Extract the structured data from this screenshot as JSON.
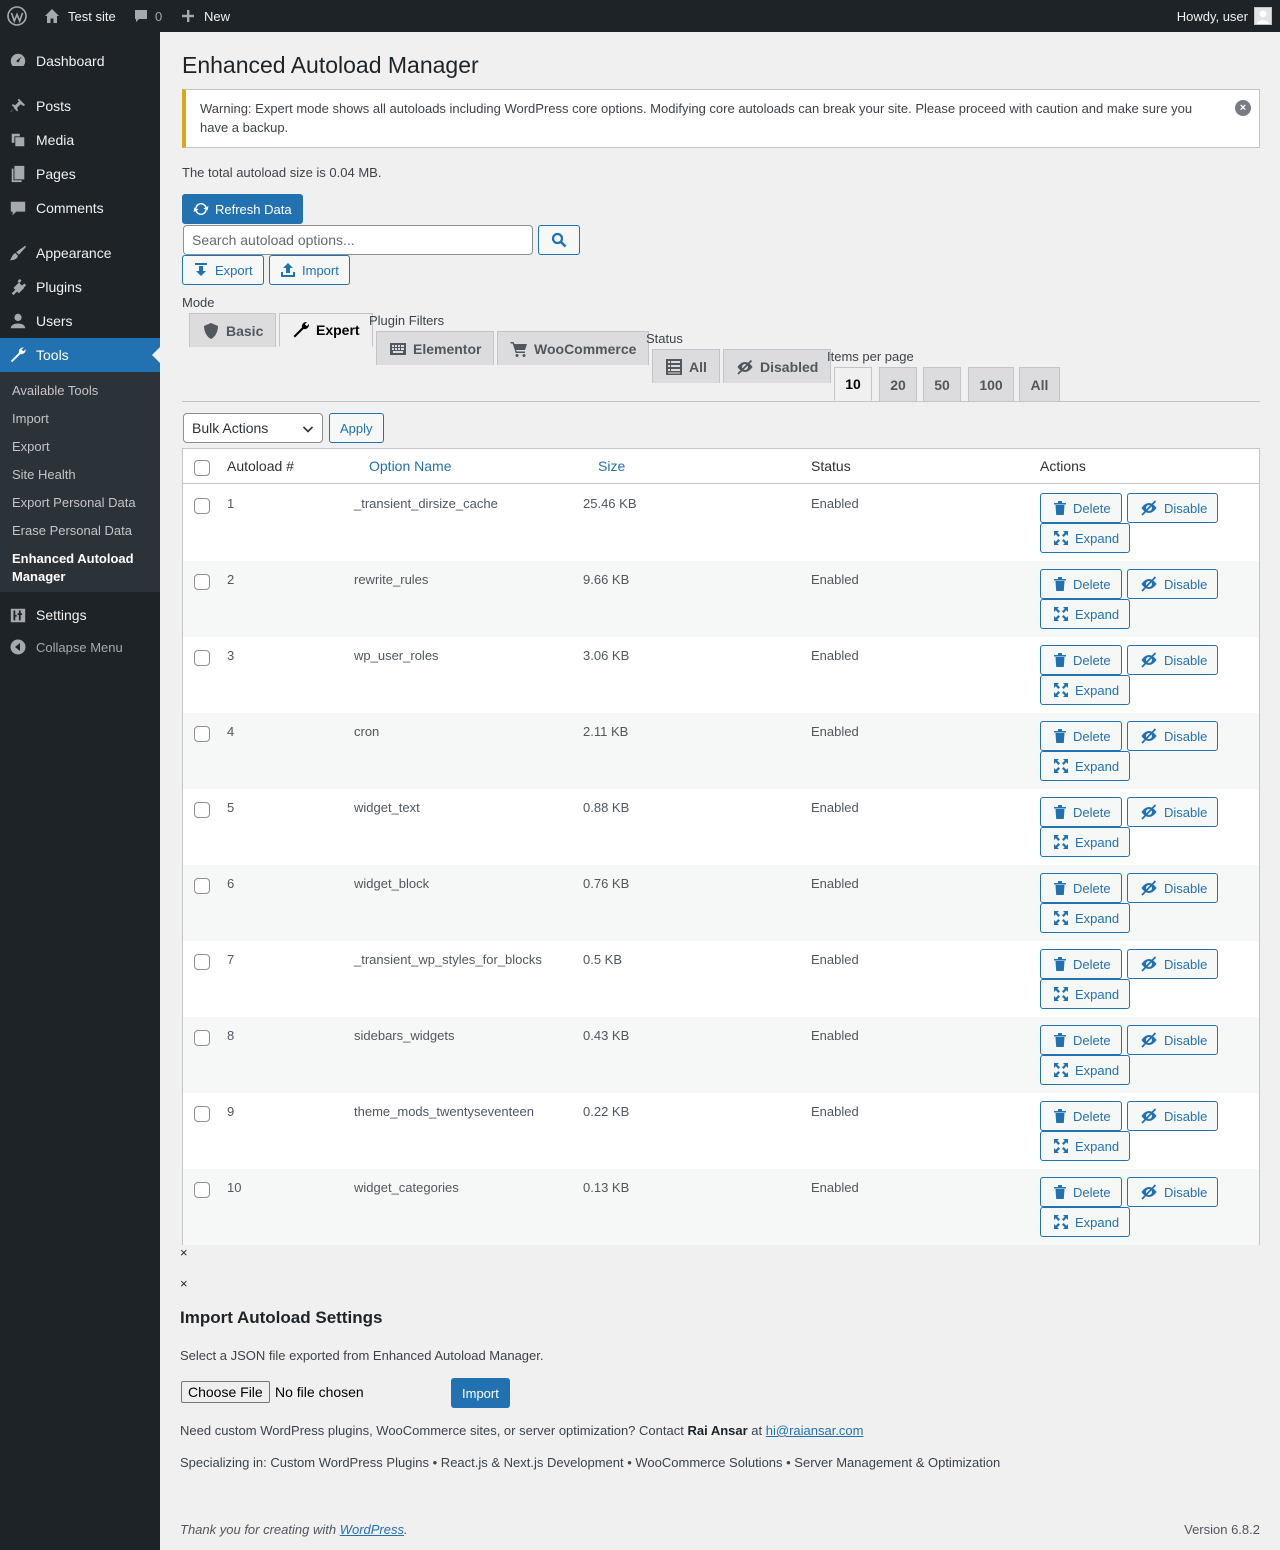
{
  "admin_bar": {
    "site_name": "Test site",
    "comments_count": "0",
    "new_label": "New",
    "howdy": "Howdy, user"
  },
  "sidebar": {
    "items": [
      {
        "label": "Dashboard",
        "icon": "dashboard-icon"
      },
      {
        "label": "Posts",
        "icon": "pin-icon"
      },
      {
        "label": "Media",
        "icon": "media-icon"
      },
      {
        "label": "Pages",
        "icon": "pages-icon"
      },
      {
        "label": "Comments",
        "icon": "comment-icon"
      },
      {
        "label": "Appearance",
        "icon": "brush-icon"
      },
      {
        "label": "Plugins",
        "icon": "plug-icon"
      },
      {
        "label": "Users",
        "icon": "user-icon"
      },
      {
        "label": "Tools",
        "icon": "wrench-icon"
      },
      {
        "label": "Settings",
        "icon": "sliders-icon"
      }
    ],
    "submenu": [
      "Available Tools",
      "Import",
      "Export",
      "Site Health",
      "Export Personal Data",
      "Erase Personal Data",
      "Enhanced Autoload Manager"
    ],
    "collapse_label": "Collapse Menu"
  },
  "page": {
    "title": "Enhanced Autoload Manager",
    "warning": "Warning: Expert mode shows all autoloads including WordPress core options. Modifying core autoloads can break your site. Please proceed with caution and make sure you have a backup.",
    "total_size_text": "The total autoload size is 0.04 MB.",
    "refresh_label": "Refresh Data",
    "search_placeholder": "Search autoload options...",
    "export_label": "Export",
    "import_label": "Import"
  },
  "filters": {
    "mode_label": "Mode",
    "mode_tabs": [
      "Basic",
      "Expert"
    ],
    "mode_active": "Expert",
    "plugin_filters_label": "Plugin Filters",
    "plugin_tabs": [
      "Elementor",
      "WooCommerce"
    ],
    "status_label": "Status",
    "status_tabs": [
      "All",
      "Disabled"
    ],
    "items_per_page_label": "Items per page",
    "per_page_tabs": [
      "10",
      "20",
      "50",
      "100",
      "All"
    ],
    "per_page_active": "10"
  },
  "bulk": {
    "selected": "Bulk Actions",
    "apply_label": "Apply"
  },
  "table": {
    "columns": [
      "Autoload #",
      "Option Name",
      "Size",
      "Status",
      "Actions"
    ],
    "action_labels": {
      "delete": "Delete",
      "disable": "Disable",
      "expand": "Expand"
    },
    "rows": [
      {
        "num": "1",
        "name": "_transient_dirsize_cache",
        "size": "25.46 KB",
        "status": "Enabled"
      },
      {
        "num": "2",
        "name": "rewrite_rules",
        "size": "9.66 KB",
        "status": "Enabled"
      },
      {
        "num": "3",
        "name": "wp_user_roles",
        "size": "3.06 KB",
        "status": "Enabled"
      },
      {
        "num": "4",
        "name": "cron",
        "size": "2.11 KB",
        "status": "Enabled"
      },
      {
        "num": "5",
        "name": "widget_text",
        "size": "0.88 KB",
        "status": "Enabled"
      },
      {
        "num": "6",
        "name": "widget_block",
        "size": "0.76 KB",
        "status": "Enabled"
      },
      {
        "num": "7",
        "name": "_transient_wp_styles_for_blocks",
        "size": "0.5 KB",
        "status": "Enabled"
      },
      {
        "num": "8",
        "name": "sidebars_widgets",
        "size": "0.43 KB",
        "status": "Enabled"
      },
      {
        "num": "9",
        "name": "theme_mods_twentyseventeen",
        "size": "0.22 KB",
        "status": "Enabled"
      },
      {
        "num": "10",
        "name": "widget_categories",
        "size": "0.13 KB",
        "status": "Enabled"
      }
    ]
  },
  "import_section": {
    "close_glyph": "×",
    "title": "Import Autoload Settings",
    "description": "Select a JSON file exported from Enhanced Autoload Manager.",
    "choose_file_label": "Choose File",
    "file_status": "No file chosen",
    "import_button": "Import",
    "contact_prefix": "Need custom WordPress plugins, WooCommerce sites, or server optimization? Contact ",
    "contact_name": "Rai Ansar",
    "contact_at": " at ",
    "contact_email": "hi@raiansar.com",
    "specializing": "Specializing in: Custom WordPress Plugins • React.js & Next.js Development • WooCommerce Solutions • Server Management & Optimization"
  },
  "footer": {
    "thanks_prefix": "Thank you for creating with ",
    "thanks_link": "WordPress",
    "thanks_suffix": ".",
    "version": "Version 6.8.2"
  },
  "colors": {
    "primary": "#2271b1",
    "admin_dark": "#1d2327",
    "warning": "#dba617"
  }
}
